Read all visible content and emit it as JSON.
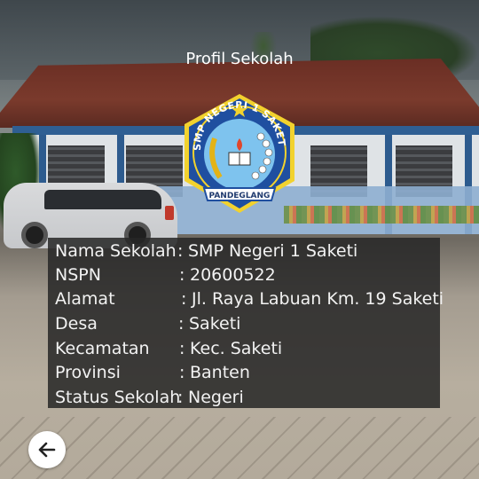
{
  "header": {
    "title": "Profil Sekolah"
  },
  "logo": {
    "top_text": "SMP NEGERI 1 SAKETI",
    "banner_text": "PANDEGLANG",
    "colors": {
      "outer": "#1f4fa0",
      "inner": "#7ec3ee",
      "gold": "#e3b317",
      "border": "#f2d22e"
    }
  },
  "profile": {
    "rows": [
      {
        "label": "Nama Sekolah",
        "sep": ":",
        "value": "SMP Negeri 1 Saketi"
      },
      {
        "label": "NSPN",
        "sep": ":",
        "value": "20600522"
      },
      {
        "label": "Alamat",
        "sep": ":",
        "value": "Jl. Raya Labuan Km. 19 Saketi"
      },
      {
        "label": "Desa",
        "sep": ":",
        "value": "Saketi"
      },
      {
        "label": "Kecamatan",
        "sep": ":",
        "value": "Kec. Saketi"
      },
      {
        "label": "Provinsi",
        "sep": ":",
        "value": "Banten"
      },
      {
        "label": "Status Sekolah",
        "sep": ":",
        "value": "Negeri"
      }
    ]
  },
  "nav": {
    "back_icon": "arrow-left-icon"
  }
}
